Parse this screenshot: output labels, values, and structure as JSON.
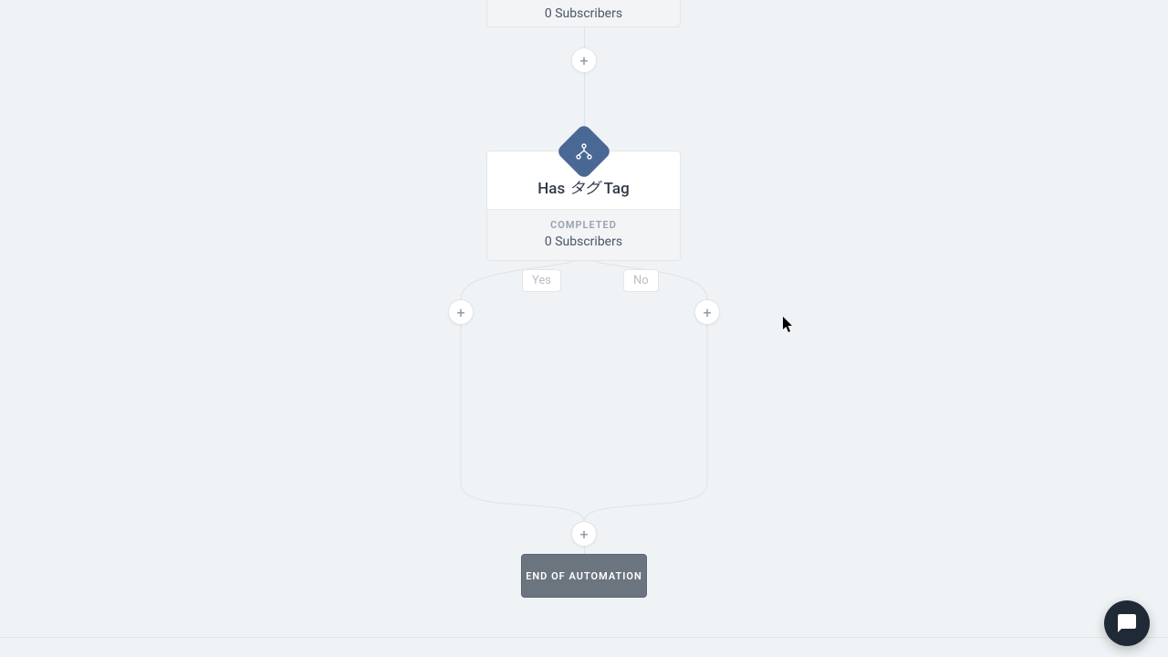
{
  "top_node": {
    "subscribers_text": "0 Subscribers"
  },
  "condition_node": {
    "title_prefix": "Has ",
    "title_em": "タグ",
    "title_suffix": " Tag",
    "status_label": "COMPLETED",
    "subscribers_text": "0 Subscribers"
  },
  "branches": {
    "yes_label": "Yes",
    "no_label": "No"
  },
  "end_node": {
    "label": "END OF AUTOMATION"
  },
  "icons": {
    "add": "+",
    "condition": "branch-icon",
    "chat": "chat-icon"
  },
  "colors": {
    "accent": "#4a6894",
    "bg": "#f0f3f5"
  }
}
